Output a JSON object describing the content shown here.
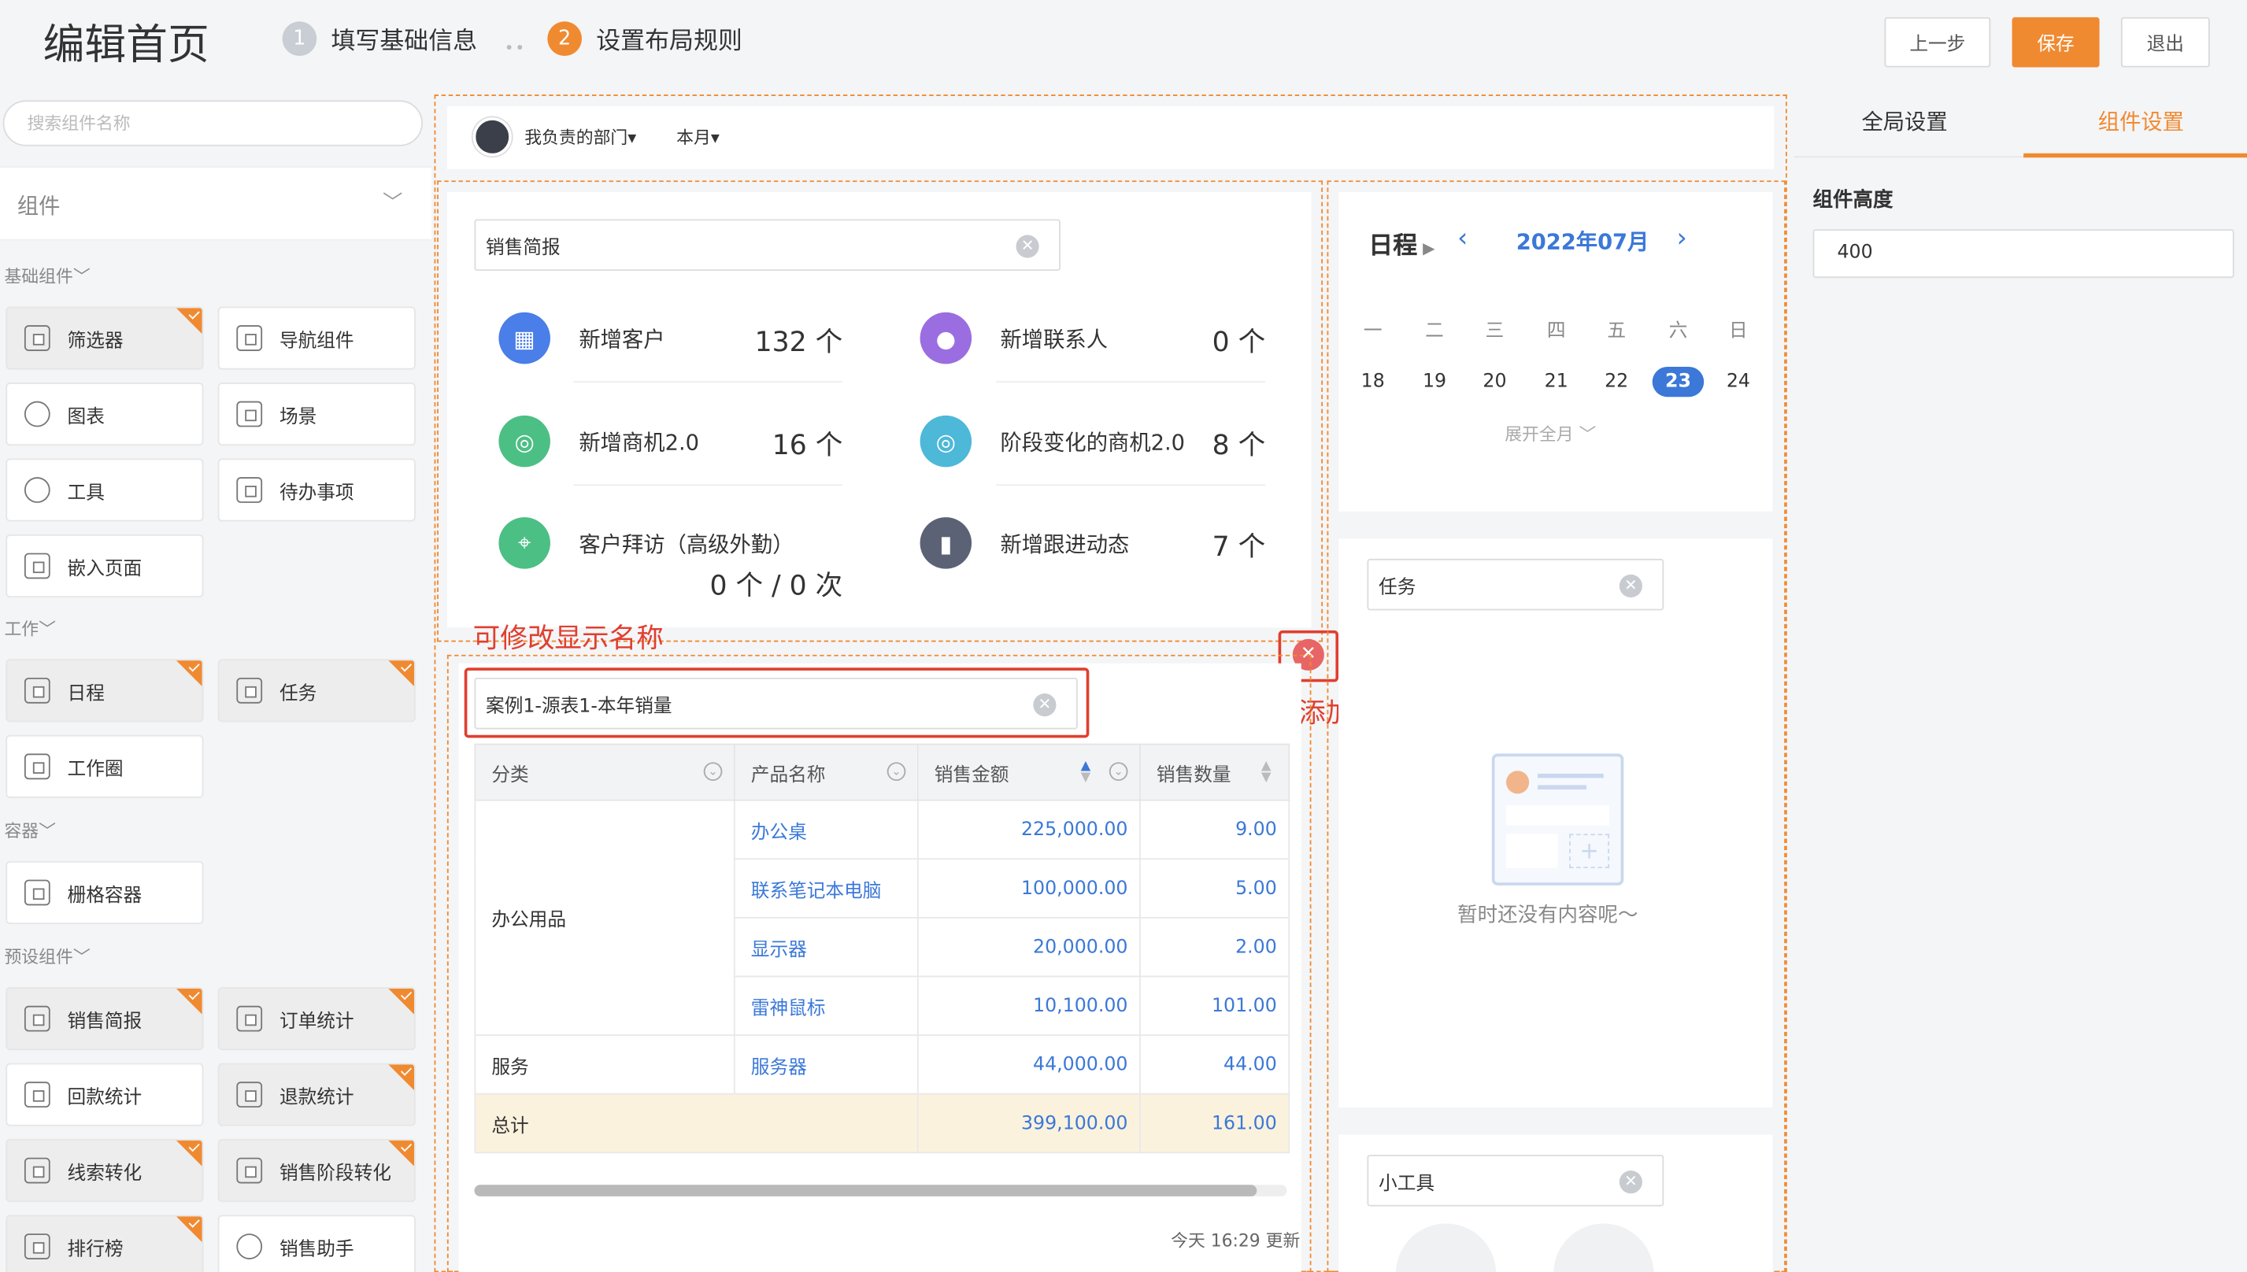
{
  "header": {
    "title": "编辑首页",
    "steps": [
      {
        "num": "1",
        "label": "填写基础信息"
      },
      {
        "num": "2",
        "label": "设置布局规则"
      }
    ],
    "dots": "••",
    "prev": "上一步",
    "save": "保存",
    "exit": "退出"
  },
  "left": {
    "search_placeholder": "搜索组件名称",
    "component_bar": "组件",
    "sections": {
      "basic": "基础组件",
      "work": "工作",
      "container": "容器",
      "preset": "预设组件"
    },
    "basic_items": [
      "筛选器",
      "导航组件",
      "图表",
      "场景",
      "工具",
      "待办事项",
      "嵌入页面"
    ],
    "work_items": [
      "日程",
      "任务",
      "工作圈"
    ],
    "container_items": [
      "栅格容器"
    ],
    "preset_items": [
      "销售简报",
      "订单统计",
      "回款统计",
      "退款统计",
      "线索转化",
      "销售阶段转化",
      "排行榜",
      "销售助手"
    ]
  },
  "filter": {
    "dept": "我负责的部门",
    "period": "本月"
  },
  "brief": {
    "name": "销售简报",
    "stats": [
      {
        "label": "新增客户",
        "value": "132 个",
        "color": "#4a7ee8"
      },
      {
        "label": "新增联系人",
        "value": "0 个",
        "color": "#9a6ee0"
      },
      {
        "label": "新增商机2.0",
        "value": "16 个",
        "color": "#4cbf85"
      },
      {
        "label": "阶段变化的商机2.0",
        "value": "8 个",
        "color": "#4db8d8"
      },
      {
        "label": "客户拜访（高级外勤）",
        "value": "0 个  /  0 次",
        "color": "#4cbf85"
      },
      {
        "label": "新增跟进动态",
        "value": "7 个",
        "color": "#5c6275"
      }
    ]
  },
  "annotations": {
    "rename": "可修改显示名称",
    "delete": "可删除已添加的组件"
  },
  "report": {
    "name": "案例1-源表1-本年销量",
    "headers": [
      "分类",
      "产品名称",
      "销售金额",
      "销售数量"
    ],
    "groups": [
      {
        "category": "办公用品",
        "rows": [
          [
            "办公桌",
            "225,000.00",
            "9.00"
          ],
          [
            "联系笔记本电脑",
            "100,000.00",
            "5.00"
          ],
          [
            "显示器",
            "20,000.00",
            "2.00"
          ],
          [
            "雷神鼠标",
            "10,100.00",
            "101.00"
          ]
        ]
      },
      {
        "category": "服务",
        "rows": [
          [
            "服务器",
            "44,000.00",
            "44.00"
          ]
        ]
      }
    ],
    "total": {
      "label": "总计",
      "amount": "399,100.00",
      "qty": "161.00"
    },
    "updated": "今天 16:29 更新"
  },
  "schedule": {
    "title": "日程",
    "month": "2022年07月",
    "weekdays": [
      "一",
      "二",
      "三",
      "四",
      "五",
      "六",
      "日"
    ],
    "days": [
      "18",
      "19",
      "20",
      "21",
      "22",
      "23",
      "24"
    ],
    "today": "23",
    "expand": "展开全月"
  },
  "task": {
    "name": "任务",
    "empty": "暂时还没有内容呢～"
  },
  "tools": {
    "name": "小工具"
  },
  "settings": {
    "tabs": [
      "全局设置",
      "组件设置"
    ],
    "height_label": "组件高度",
    "height_value": "400"
  },
  "colors": {
    "accent": "#f08a31",
    "link": "#3b78d8",
    "annotation": "#e03f2f"
  }
}
